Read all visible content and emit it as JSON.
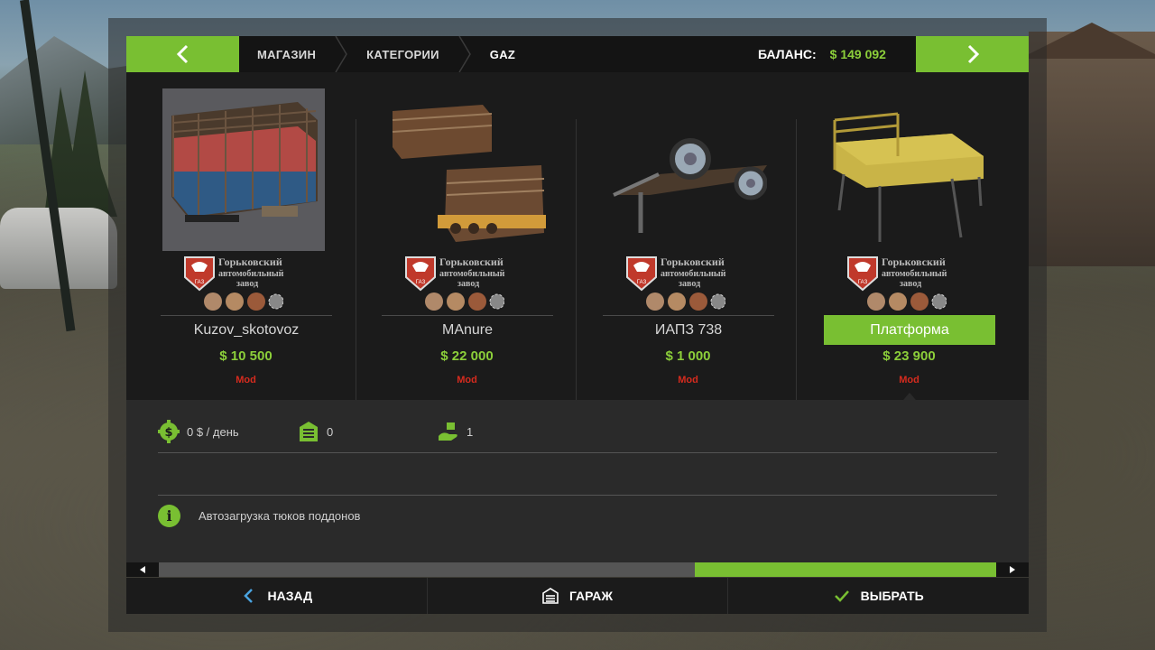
{
  "header": {
    "breadcrumb": [
      "МАГАЗИН",
      "КАТЕГОРИИ",
      "GAZ"
    ],
    "balance_label": "БАЛАНС:",
    "balance_value": "$ 149 092"
  },
  "brand": {
    "logo_text": [
      "Горьковский",
      "автомобильный",
      "завод"
    ],
    "badge": "ГАЗ"
  },
  "items": [
    {
      "name": "Kuzov_skotovoz",
      "price": "$ 10 500",
      "tag": "Mod",
      "icon": "livestock-body-icon"
    },
    {
      "name": "MAnure",
      "price": "$ 22 000",
      "tag": "Mod",
      "icon": "manure-spreader-icon"
    },
    {
      "name": "ИАПЗ 738",
      "price": "$ 1 000",
      "tag": "Mod",
      "icon": "trailer-chassis-icon"
    },
    {
      "name": "Платформа",
      "price": "$ 23 900",
      "tag": "Mod",
      "icon": "flatbed-platform-icon"
    }
  ],
  "details": {
    "maintenance": "0 $ / день",
    "storage": "0",
    "units": "1",
    "info": "Автозагрузка тюков поддонов"
  },
  "scroll": {
    "position_fraction": 0.66,
    "visible_fraction": 0.36
  },
  "bottom": {
    "back_label": "НАЗАД",
    "garage_label": "ГАРАЖ",
    "select_label": "ВЫБРАТЬ"
  },
  "colors": {
    "accent": "#79bf32",
    "price": "#8ccf3a",
    "mod": "#d62b1e"
  }
}
